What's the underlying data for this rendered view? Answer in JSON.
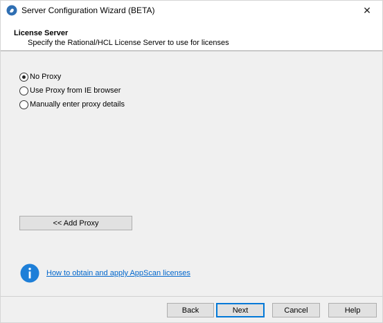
{
  "window": {
    "title": "Server Configuration Wizard (BETA)",
    "close_glyph": "✕"
  },
  "header": {
    "title": "License Server",
    "subtitle": "Specify the Rational/HCL License Server to use for licenses"
  },
  "proxy_options": [
    {
      "label": "No Proxy",
      "checked": true
    },
    {
      "label": "Use Proxy from IE browser",
      "checked": false
    },
    {
      "label": "Manually enter proxy details",
      "checked": false
    }
  ],
  "add_proxy_label": "<< Add Proxy",
  "help_link": "How to obtain and apply AppScan licenses",
  "footer": {
    "back": "Back",
    "next": "Next",
    "cancel": "Cancel",
    "help": "Help"
  },
  "colors": {
    "accent": "#0078d7",
    "info_icon": "#1e7fd8",
    "link": "#0066cc"
  },
  "icons": [
    "app-icon",
    "close-icon",
    "info-icon"
  ]
}
